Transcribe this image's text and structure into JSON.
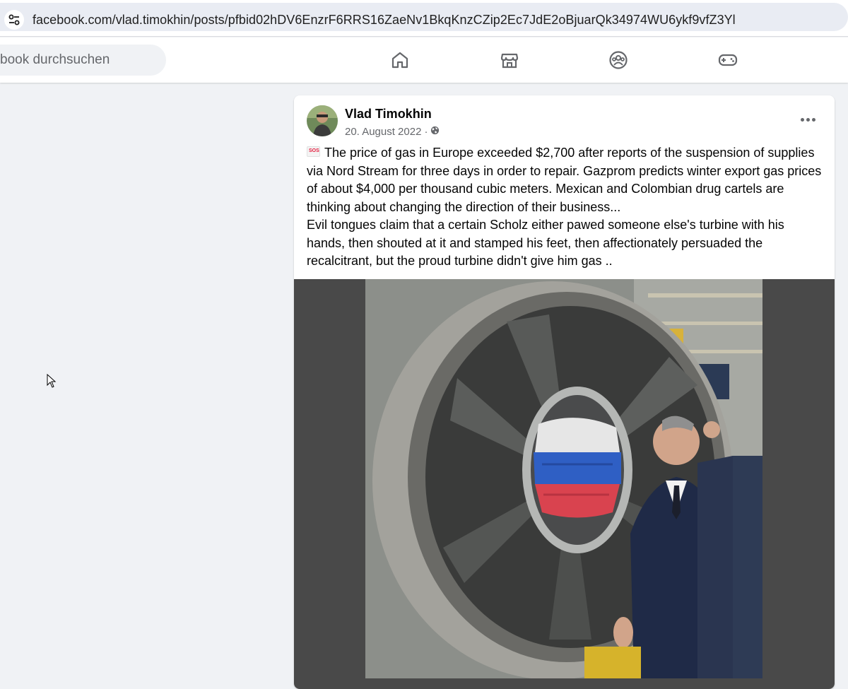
{
  "browser": {
    "url": "facebook.com/vlad.timokhin/posts/pfbid02hDV6EnzrF6RRS16ZaeNv1BkqKnzCZip2Ec7JdE2oBjuarQk34974WU6ykf9vfZ3Yl",
    "site_settings_icon": "tune-icon"
  },
  "nav": {
    "search_placeholder": "book durchsuchen",
    "icons": [
      "home-icon",
      "marketplace-icon",
      "groups-icon",
      "gaming-icon"
    ]
  },
  "post": {
    "author": "Vlad Timokhin",
    "date": "20. August 2022",
    "separator": "·",
    "audience_icon": "globe-icon",
    "emoji": "SOS",
    "paragraph_1": "The price of gas in Europe exceeded $2,700 after reports of the suspension of supplies via Nord Stream for three days in order to repair. Gazprom predicts winter export gas prices of about $4,000 per thousand cubic meters. Mexican and Colombian drug cartels are thinking about changing the direction of their business...",
    "paragraph_2": "Evil tongues claim that a certain Scholz either pawed someone else's turbine with his hands, then shouted at it and stamped his feet, then affectionately persuaded the recalcitrant, but the proud turbine didn't give him gas .."
  },
  "colors": {
    "page_bg": "#f0f2f5",
    "card_bg": "#ffffff",
    "secondary_text": "#65676b",
    "media_bg": "#494949"
  }
}
